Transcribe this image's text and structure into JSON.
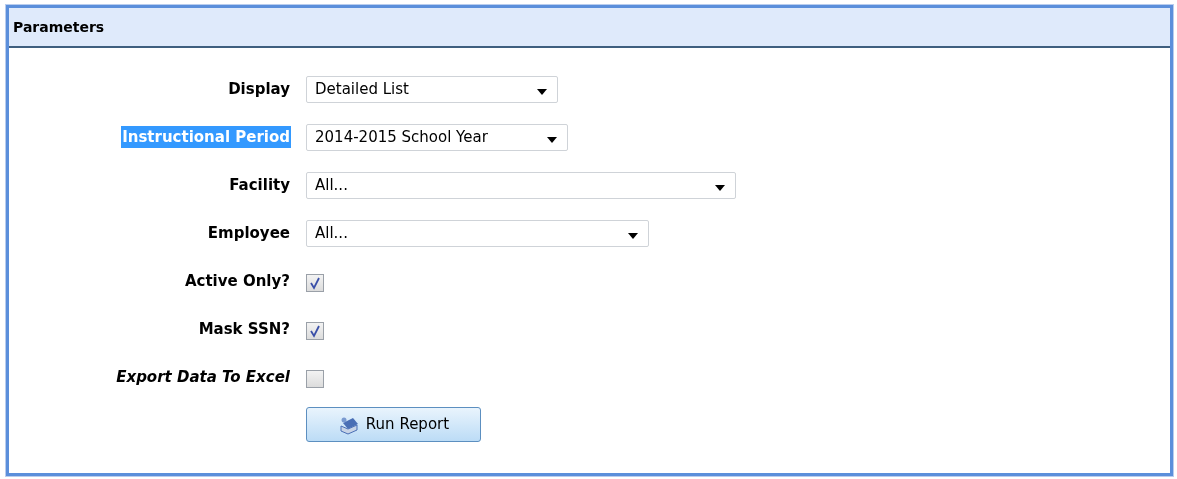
{
  "panel": {
    "title": "Parameters"
  },
  "fields": [
    {
      "kind": "select",
      "label": "Display",
      "value": "Detailed List",
      "highlighted": false,
      "italic": false
    },
    {
      "kind": "select",
      "label": "Instructional Period",
      "value": "2014-2015 School Year",
      "highlighted": true,
      "italic": false
    },
    {
      "kind": "select",
      "label": "Facility",
      "value": "All...",
      "highlighted": false,
      "italic": false
    },
    {
      "kind": "select",
      "label": "Employee",
      "value": "All...",
      "highlighted": false,
      "italic": false
    },
    {
      "kind": "checkbox",
      "label": "Active Only?",
      "checked": true,
      "highlighted": false,
      "italic": false
    },
    {
      "kind": "checkbox",
      "label": "Mask SSN?",
      "checked": true,
      "highlighted": false,
      "italic": false
    },
    {
      "kind": "checkbox",
      "label": "Export Data To Excel",
      "checked": false,
      "highlighted": false,
      "italic": true
    }
  ],
  "button": {
    "label": "Run Report"
  }
}
